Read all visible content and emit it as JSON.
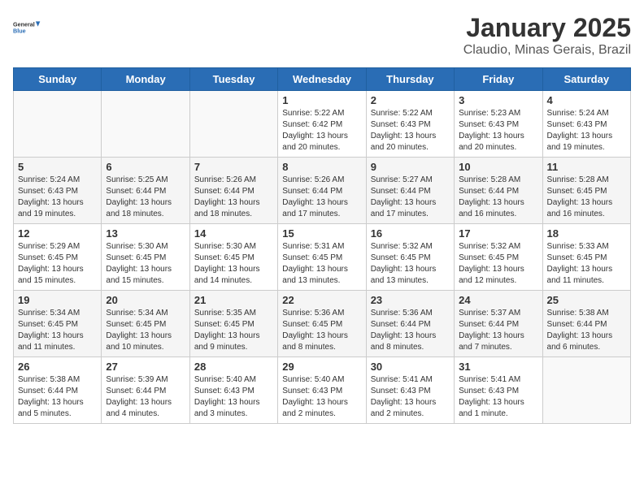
{
  "logo": {
    "line1": "General",
    "line2": "Blue"
  },
  "title": "January 2025",
  "subtitle": "Claudio, Minas Gerais, Brazil",
  "weekdays": [
    "Sunday",
    "Monday",
    "Tuesday",
    "Wednesday",
    "Thursday",
    "Friday",
    "Saturday"
  ],
  "weeks": [
    [
      {
        "day": "",
        "info": ""
      },
      {
        "day": "",
        "info": ""
      },
      {
        "day": "",
        "info": ""
      },
      {
        "day": "1",
        "info": "Sunrise: 5:22 AM\nSunset: 6:42 PM\nDaylight: 13 hours and 20 minutes."
      },
      {
        "day": "2",
        "info": "Sunrise: 5:22 AM\nSunset: 6:43 PM\nDaylight: 13 hours and 20 minutes."
      },
      {
        "day": "3",
        "info": "Sunrise: 5:23 AM\nSunset: 6:43 PM\nDaylight: 13 hours and 20 minutes."
      },
      {
        "day": "4",
        "info": "Sunrise: 5:24 AM\nSunset: 6:43 PM\nDaylight: 13 hours and 19 minutes."
      }
    ],
    [
      {
        "day": "5",
        "info": "Sunrise: 5:24 AM\nSunset: 6:43 PM\nDaylight: 13 hours and 19 minutes."
      },
      {
        "day": "6",
        "info": "Sunrise: 5:25 AM\nSunset: 6:44 PM\nDaylight: 13 hours and 18 minutes."
      },
      {
        "day": "7",
        "info": "Sunrise: 5:26 AM\nSunset: 6:44 PM\nDaylight: 13 hours and 18 minutes."
      },
      {
        "day": "8",
        "info": "Sunrise: 5:26 AM\nSunset: 6:44 PM\nDaylight: 13 hours and 17 minutes."
      },
      {
        "day": "9",
        "info": "Sunrise: 5:27 AM\nSunset: 6:44 PM\nDaylight: 13 hours and 17 minutes."
      },
      {
        "day": "10",
        "info": "Sunrise: 5:28 AM\nSunset: 6:44 PM\nDaylight: 13 hours and 16 minutes."
      },
      {
        "day": "11",
        "info": "Sunrise: 5:28 AM\nSunset: 6:45 PM\nDaylight: 13 hours and 16 minutes."
      }
    ],
    [
      {
        "day": "12",
        "info": "Sunrise: 5:29 AM\nSunset: 6:45 PM\nDaylight: 13 hours and 15 minutes."
      },
      {
        "day": "13",
        "info": "Sunrise: 5:30 AM\nSunset: 6:45 PM\nDaylight: 13 hours and 15 minutes."
      },
      {
        "day": "14",
        "info": "Sunrise: 5:30 AM\nSunset: 6:45 PM\nDaylight: 13 hours and 14 minutes."
      },
      {
        "day": "15",
        "info": "Sunrise: 5:31 AM\nSunset: 6:45 PM\nDaylight: 13 hours and 13 minutes."
      },
      {
        "day": "16",
        "info": "Sunrise: 5:32 AM\nSunset: 6:45 PM\nDaylight: 13 hours and 13 minutes."
      },
      {
        "day": "17",
        "info": "Sunrise: 5:32 AM\nSunset: 6:45 PM\nDaylight: 13 hours and 12 minutes."
      },
      {
        "day": "18",
        "info": "Sunrise: 5:33 AM\nSunset: 6:45 PM\nDaylight: 13 hours and 11 minutes."
      }
    ],
    [
      {
        "day": "19",
        "info": "Sunrise: 5:34 AM\nSunset: 6:45 PM\nDaylight: 13 hours and 11 minutes."
      },
      {
        "day": "20",
        "info": "Sunrise: 5:34 AM\nSunset: 6:45 PM\nDaylight: 13 hours and 10 minutes."
      },
      {
        "day": "21",
        "info": "Sunrise: 5:35 AM\nSunset: 6:45 PM\nDaylight: 13 hours and 9 minutes."
      },
      {
        "day": "22",
        "info": "Sunrise: 5:36 AM\nSunset: 6:45 PM\nDaylight: 13 hours and 8 minutes."
      },
      {
        "day": "23",
        "info": "Sunrise: 5:36 AM\nSunset: 6:44 PM\nDaylight: 13 hours and 8 minutes."
      },
      {
        "day": "24",
        "info": "Sunrise: 5:37 AM\nSunset: 6:44 PM\nDaylight: 13 hours and 7 minutes."
      },
      {
        "day": "25",
        "info": "Sunrise: 5:38 AM\nSunset: 6:44 PM\nDaylight: 13 hours and 6 minutes."
      }
    ],
    [
      {
        "day": "26",
        "info": "Sunrise: 5:38 AM\nSunset: 6:44 PM\nDaylight: 13 hours and 5 minutes."
      },
      {
        "day": "27",
        "info": "Sunrise: 5:39 AM\nSunset: 6:44 PM\nDaylight: 13 hours and 4 minutes."
      },
      {
        "day": "28",
        "info": "Sunrise: 5:40 AM\nSunset: 6:43 PM\nDaylight: 13 hours and 3 minutes."
      },
      {
        "day": "29",
        "info": "Sunrise: 5:40 AM\nSunset: 6:43 PM\nDaylight: 13 hours and 2 minutes."
      },
      {
        "day": "30",
        "info": "Sunrise: 5:41 AM\nSunset: 6:43 PM\nDaylight: 13 hours and 2 minutes."
      },
      {
        "day": "31",
        "info": "Sunrise: 5:41 AM\nSunset: 6:43 PM\nDaylight: 13 hours and 1 minute."
      },
      {
        "day": "",
        "info": ""
      }
    ]
  ]
}
